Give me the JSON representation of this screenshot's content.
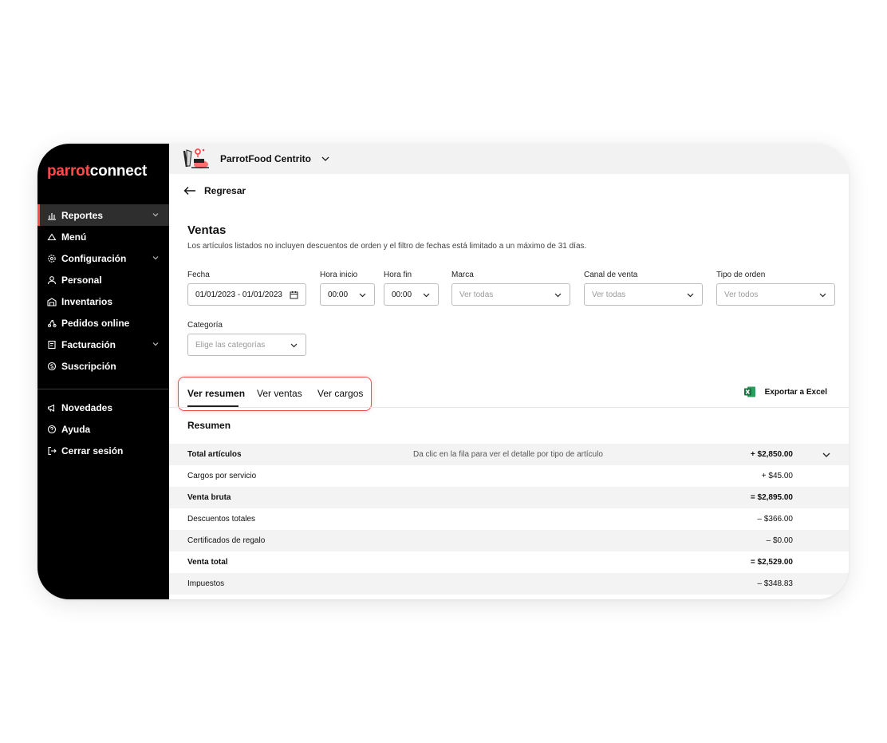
{
  "logo": {
    "part1": "parrot",
    "part2": "connect"
  },
  "sidebar": {
    "items": [
      {
        "label": "Reportes",
        "icon": "chart-icon",
        "active": true,
        "has_chevron": true
      },
      {
        "label": "Menú",
        "icon": "home-icon",
        "active": false,
        "has_chevron": false
      },
      {
        "label": "Configuración",
        "icon": "gear-icon",
        "active": false,
        "has_chevron": true
      },
      {
        "label": "Personal",
        "icon": "user-icon",
        "active": false,
        "has_chevron": false
      },
      {
        "label": "Inventarios",
        "icon": "warehouse-icon",
        "active": false,
        "has_chevron": false
      },
      {
        "label": "Pedidos online",
        "icon": "delivery-icon",
        "active": false,
        "has_chevron": false
      },
      {
        "label": "Facturación",
        "icon": "invoice-icon",
        "active": false,
        "has_chevron": true
      },
      {
        "label": "Suscripción",
        "icon": "subscription-icon",
        "active": false,
        "has_chevron": false
      }
    ],
    "bottom_items": [
      {
        "label": "Novedades",
        "icon": "megaphone-icon"
      },
      {
        "label": "Ayuda",
        "icon": "help-icon"
      },
      {
        "label": "Cerrar sesión",
        "icon": "logout-icon"
      }
    ]
  },
  "topbar": {
    "store_name": "ParrotFood Centrito"
  },
  "back": {
    "label": "Regresar"
  },
  "page": {
    "title": "Ventas",
    "subtitle": "Los artículos listados no incluyen descuentos de orden y el filtro de fechas está limitado a un máximo de 31 días."
  },
  "filters": {
    "fecha": {
      "label": "Fecha",
      "value": "01/01/2023 - 01/01/2023"
    },
    "hora_inicio": {
      "label": "Hora inicio",
      "value": "00:00"
    },
    "hora_fin": {
      "label": "Hora fin",
      "value": "00:00"
    },
    "marca": {
      "label": "Marca",
      "placeholder": "Ver todas"
    },
    "canal": {
      "label": "Canal de venta",
      "placeholder": "Ver todas"
    },
    "tipo_orden": {
      "label": "Tipo de orden",
      "placeholder": "Ver todos"
    },
    "categoria": {
      "label": "Categoría",
      "placeholder": "Elige las categorías"
    }
  },
  "tabs": [
    {
      "label": "Ver resumen",
      "active": true
    },
    {
      "label": "Ver ventas",
      "active": false
    },
    {
      "label": "Ver cargos",
      "active": false
    }
  ],
  "export": {
    "label": "Exportar a Excel"
  },
  "summary": {
    "title": "Resumen",
    "hint": "Da clic en la fila para ver el detalle por tipo de artículo",
    "rows": [
      {
        "label": "Total artículos",
        "value": "+ $2,850.00",
        "bold": true,
        "shaded": true
      },
      {
        "label": "Cargos por servicio",
        "value": "+ $45.00",
        "bold": false,
        "shaded": false
      },
      {
        "label": "Venta bruta",
        "value": "= $2,895.00",
        "bold": true,
        "shaded": true
      },
      {
        "label": "Descuentos totales",
        "value": "– $366.00",
        "bold": false,
        "shaded": false
      },
      {
        "label": "Certificados de regalo",
        "value": "– $0.00",
        "bold": false,
        "shaded": true
      },
      {
        "label": "Venta total",
        "value": "= $2,529.00",
        "bold": true,
        "shaded": false
      },
      {
        "label": "Impuestos",
        "value": "– $348.83",
        "bold": false,
        "shaded": true
      }
    ]
  },
  "colors": {
    "brand_red": "#ff4b4b",
    "sidebar_bg": "#000000",
    "highlight_border": "#f04e4e",
    "excel_green": "#1d7044"
  }
}
